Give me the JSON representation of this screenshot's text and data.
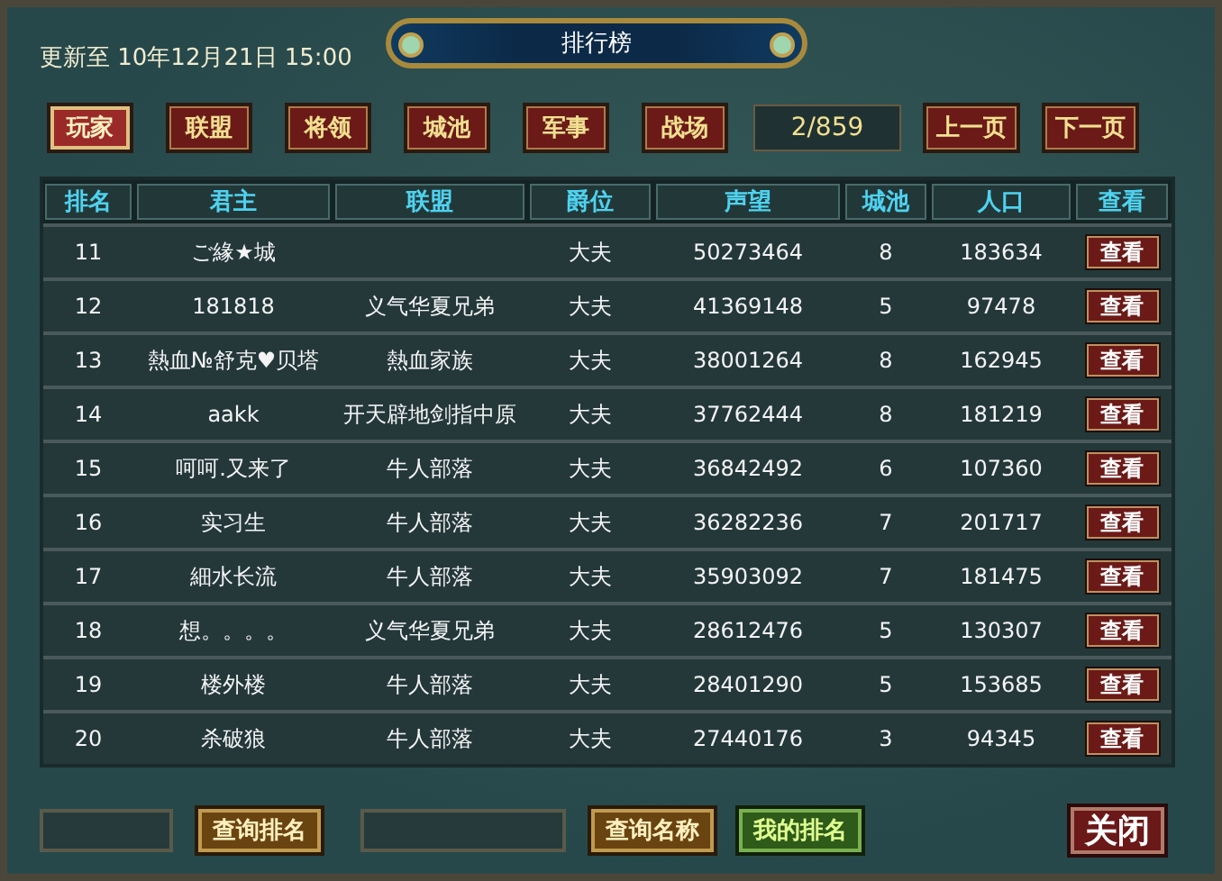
{
  "header": {
    "update_time": "更新至 10年12月21日 15:00",
    "title": "排行榜"
  },
  "tabs": [
    {
      "label": "玩家",
      "selected": true
    },
    {
      "label": "联盟",
      "selected": false
    },
    {
      "label": "将领",
      "selected": false
    },
    {
      "label": "城池",
      "selected": false
    },
    {
      "label": "军事",
      "selected": false
    },
    {
      "label": "战场",
      "selected": false
    }
  ],
  "pager": {
    "page": "2/859",
    "prev": "上一页",
    "next": "下一页"
  },
  "table": {
    "columns": [
      "排名",
      "君主",
      "联盟",
      "爵位",
      "声望",
      "城池",
      "人口",
      "查看"
    ],
    "rows": [
      {
        "rank": "11",
        "lord": "ご緣★城",
        "title": "大夫",
        "prestige": "50273464",
        "cities": "8",
        "population": "183634",
        "action": "查看"
      },
      {
        "rank": "12",
        "lord": "181818",
        "alliance": "义气华夏兄弟",
        "title": "大夫",
        "prestige": "41369148",
        "cities": "5",
        "population": "97478",
        "action": "查看"
      },
      {
        "rank": "13",
        "lord": "熱血№舒克♥贝塔",
        "alliance": "熱血家族",
        "title": "大夫",
        "prestige": "38001264",
        "cities": "8",
        "population": "162945",
        "action": "查看"
      },
      {
        "rank": "14",
        "lord": "aakk",
        "alliance": "开天辟地剑指中原",
        "title": "大夫",
        "prestige": "37762444",
        "cities": "8",
        "population": "181219",
        "action": "查看"
      },
      {
        "rank": "15",
        "lord": "呵呵.又来了",
        "alliance": "牛人部落",
        "title": "大夫",
        "prestige": "36842492",
        "cities": "6",
        "population": "107360",
        "action": "查看"
      },
      {
        "rank": "16",
        "lord": "实习生",
        "alliance": "牛人部落",
        "title": "大夫",
        "prestige": "36282236",
        "cities": "7",
        "population": "201717",
        "action": "查看"
      },
      {
        "rank": "17",
        "lord": "細水长流",
        "alliance": "牛人部落",
        "title": "大夫",
        "prestige": "35903092",
        "cities": "7",
        "population": "181475",
        "action": "查看"
      },
      {
        "rank": "18",
        "lord": "想。。。。",
        "alliance": "义气华夏兄弟",
        "title": "大夫",
        "prestige": "28612476",
        "cities": "5",
        "population": "130307",
        "action": "查看"
      },
      {
        "rank": "19",
        "lord": "楼外楼",
        "alliance": "牛人部落",
        "title": "大夫",
        "prestige": "28401290",
        "cities": "5",
        "population": "153685",
        "action": "查看"
      },
      {
        "rank": "20",
        "lord": "杀破狼",
        "alliance": "牛人部落",
        "title": "大夫",
        "prestige": "27440176",
        "cities": "3",
        "population": "94345",
        "action": "查看"
      }
    ]
  },
  "footer": [
    {
      "kind": "field"
    },
    {
      "kind": "gold",
      "label": "查询排名"
    },
    {
      "kind": "field"
    },
    {
      "kind": "gold",
      "label": "查询名称"
    },
    {
      "kind": "green",
      "label": "我的排名"
    },
    {
      "kind": "close",
      "label": "关闭"
    }
  ]
}
